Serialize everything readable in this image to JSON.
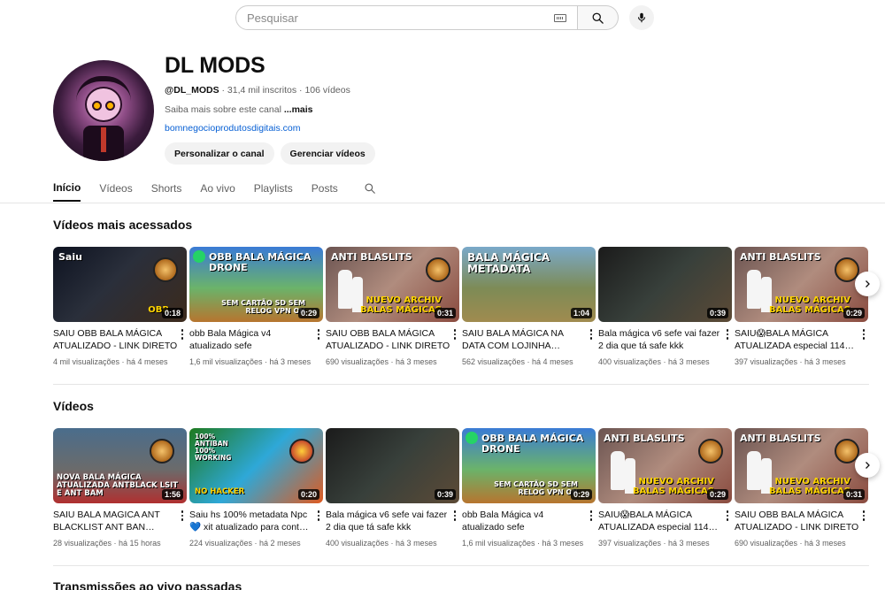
{
  "search": {
    "placeholder": "Pesquisar"
  },
  "channel": {
    "name": "DL MODS",
    "handle": "@DL_MODS",
    "subscribers": "31,4 mil inscritos",
    "video_count": "106 vídeos",
    "separator": " · ",
    "description": "Saiba mais sobre este canal ",
    "more_label": "...mais",
    "link": "bomnegocioprodutosdigitais.com",
    "customize_label": "Personalizar o canal",
    "manage_label": "Gerenciar vídeos"
  },
  "tabs": [
    "Início",
    "Vídeos",
    "Shorts",
    "Ao vivo",
    "Playlists",
    "Posts"
  ],
  "sections": {
    "popular": {
      "title": "Vídeos mais acessados",
      "videos": [
        {
          "title": "SAIU OBB BALA MÁGICA ATUALIZADO - LINK DIRETO",
          "views": "4 mil visualizações",
          "age": "há 4 meses",
          "duration": "0:18",
          "thumb_caption": "Saiu",
          "thumb_caption2": "OBB"
        },
        {
          "title": "obb Bala Mágica v4 atualizado sefe",
          "views": "1,6 mil visualizações",
          "age": "há 3 meses",
          "duration": "0:29",
          "thumb_caption": "OBB BALA MÁGICA DRONE",
          "thumb_caption2": "SEM CARTÃO SD SEM RELOG VPN ON"
        },
        {
          "title": "SAIU OBB BALA MÁGICA ATUALIZADO - LINK DIRETO",
          "views": "690 visualizações",
          "age": "há 3 meses",
          "duration": "0:31",
          "thumb_caption": "ANTI BLASLITS",
          "thumb_caption2": "NUEVO ARCHIV BALAS MÁGICAS"
        },
        {
          "title": "SAIU BALA MÁGICA NA DATA COM LOJINHA…",
          "views": "562 visualizações",
          "age": "há 4 meses",
          "duration": "1:04",
          "thumb_caption": "BALA MÁGICA METADATA",
          "thumb_caption2": ""
        },
        {
          "title": "Bala mágica v6 sefe vai fazer 2 dia que tá safe kkk",
          "views": "400 visualizações",
          "age": "há 3 meses",
          "duration": "0:39",
          "thumb_caption": "",
          "thumb_caption2": ""
        },
        {
          "title": "SAIU😱BALA MÁGICA ATUALIZADA especial 114…",
          "views": "397 visualizações",
          "age": "há 3 meses",
          "duration": "0:29",
          "thumb_caption": "ANTI BLASLITS",
          "thumb_caption2": "NUEVO ARCHIV BALAS MÁGICAS"
        }
      ]
    },
    "videos": {
      "title": "Vídeos",
      "videos": [
        {
          "title": "SAIU BALA MAGICA ANT BLACKLIST ANT BAN…",
          "views": "28 visualizações",
          "age": "há 15 horas",
          "duration": "1:56",
          "thumb_caption": "",
          "thumb_caption2": "NOVA BALA MÁGICA ATUALIZADA ANTBLACK LSIT E ANT BAM"
        },
        {
          "title": "Saiu hs 100% metadata Npc 💙 xit atualizado para cont…",
          "views": "224 visualizações",
          "age": "há 2 meses",
          "duration": "0:20",
          "thumb_caption": "100% ANTIBAN 100% WORKING",
          "thumb_caption2": "NO HACKER"
        },
        {
          "title": "Bala mágica v6 sefe vai fazer 2 dia que tá safe kkk",
          "views": "400 visualizações",
          "age": "há 3 meses",
          "duration": "0:39",
          "thumb_caption": "",
          "thumb_caption2": ""
        },
        {
          "title": "obb Bala Mágica v4 atualizado sefe",
          "views": "1,6 mil visualizações",
          "age": "há 3 meses",
          "duration": "0:29",
          "thumb_caption": "OBB BALA MÁGICA DRONE",
          "thumb_caption2": "SEM CARTÃO SD SEM RELOG VPN ON"
        },
        {
          "title": "SAIU😱BALA MÁGICA ATUALIZADA especial 114…",
          "views": "397 visualizações",
          "age": "há 3 meses",
          "duration": "0:29",
          "thumb_caption": "ANTI BLASLITS",
          "thumb_caption2": "NUEVO ARCHIV BALAS MÁGICAS"
        },
        {
          "title": "SAIU OBB BALA MÁGICA ATUALIZADO - LINK DIRETO",
          "views": "690 visualizações",
          "age": "há 3 meses",
          "duration": "0:31",
          "thumb_caption": "ANTI BLASLITS",
          "thumb_caption2": "NUEVO ARCHIV BALAS MÁGICAS"
        }
      ]
    },
    "live": {
      "title": "Transmissões ao vivo passadas"
    }
  },
  "icons": {
    "keyboard": "keyboard-icon",
    "search": "search-icon",
    "mic": "mic-icon",
    "next": "chevron-right-icon",
    "more": "more-vert-icon"
  }
}
